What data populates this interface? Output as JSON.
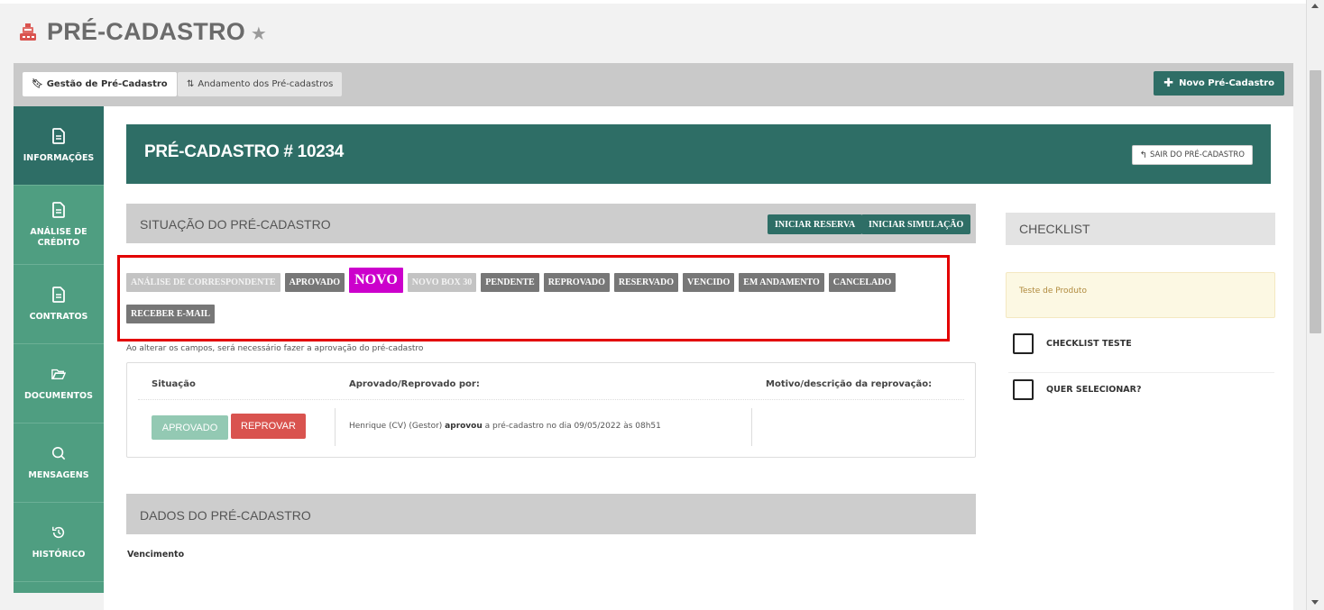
{
  "page": {
    "title": "PRÉ-CADASTRO",
    "icons": {
      "title": "cash-register-icon",
      "favorite": "star-icon"
    }
  },
  "tabs": [
    {
      "label": "Gestão de Pré-Cadastro",
      "icon": "bookmark-icon",
      "active": true
    },
    {
      "label": "Andamento dos Pré-cadastros",
      "icon": "sort-icon",
      "active": false
    }
  ],
  "toolbar": {
    "new_label": "Novo Pré-Cadastro",
    "new_icon": "plus-icon"
  },
  "sidebar": {
    "items": [
      {
        "label": "INFORMAÇÕES",
        "icon": "file-icon",
        "active": true
      },
      {
        "label": "ANÁLISE DE CRÉDITO",
        "icon": "file-icon",
        "active": false
      },
      {
        "label": "CONTRATOS",
        "icon": "file-icon",
        "active": false
      },
      {
        "label": "DOCUMENTOS",
        "icon": "folder-open-icon",
        "active": false
      },
      {
        "label": "MENSAGENS",
        "icon": "search-chat-icon",
        "active": false
      },
      {
        "label": "HISTÓRICO",
        "icon": "history-icon",
        "active": false
      }
    ]
  },
  "header": {
    "title": "PRÉ-CADASTRO # 10234",
    "exit_label": "SAIR DO PRÉ-CADASTRO",
    "exit_icon": "reply-arrow-icon"
  },
  "situacao": {
    "title": "SITUAÇÃO DO PRÉ-CADASTRO",
    "btn_reserva": "INICIAR RESERVA",
    "btn_simulacao": "INICIAR SIMULAÇÃO",
    "statuses_row1": [
      {
        "label": "ANÁLISE DE CORRESPONDENTE",
        "style": "light"
      },
      {
        "label": "APROVADO",
        "style": "dark"
      },
      {
        "label": "NOVO",
        "style": "novo"
      },
      {
        "label": "NOVO BOX 30",
        "style": "light"
      },
      {
        "label": "PENDENTE",
        "style": "dark"
      },
      {
        "label": "REPROVADO",
        "style": "dark"
      },
      {
        "label": "RESERVADO",
        "style": "dark"
      },
      {
        "label": "VENCIDO",
        "style": "dark"
      },
      {
        "label": "EM ANDAMENTO",
        "style": "dark"
      },
      {
        "label": "CANCELADO",
        "style": "dark"
      }
    ],
    "statuses_row2": [
      {
        "label": "RECEBER E-MAIL",
        "style": "dark"
      }
    ],
    "note": "Ao alterar os campos, será necessário fazer a aprovação do pré-cadastro",
    "highlight_color": "#e30000",
    "novo_color": "#cc00cc"
  },
  "approval": {
    "col_situacao": "Situação",
    "col_aprovado_por": "Aprovado/Reprovado por:",
    "col_motivo": "Motivo/descrição da reprovação:",
    "btn_aprovado": "APROVADO",
    "btn_reprovar": "REPROVAR",
    "text_pre": "Henrique (CV) (Gestor) ",
    "text_bold": "aprovou",
    "text_post": " a pré-cadastro no dia 09/05/2022 às 08h51"
  },
  "dados": {
    "title": "DADOS DO PRÉ-CADASTRO",
    "field_vencimento": "Vencimento"
  },
  "checklist": {
    "title": "CHECKLIST",
    "product": "Teste de Produto",
    "items": [
      {
        "label": "CHECKLIST TESTE",
        "checked": false
      },
      {
        "label": "QUER SELECIONAR?",
        "checked": false
      }
    ]
  },
  "colors": {
    "primary": "#2e6e66",
    "sidebar": "#4f9e81",
    "danger": "#d9534f",
    "approved_light": "#93c9b3"
  }
}
